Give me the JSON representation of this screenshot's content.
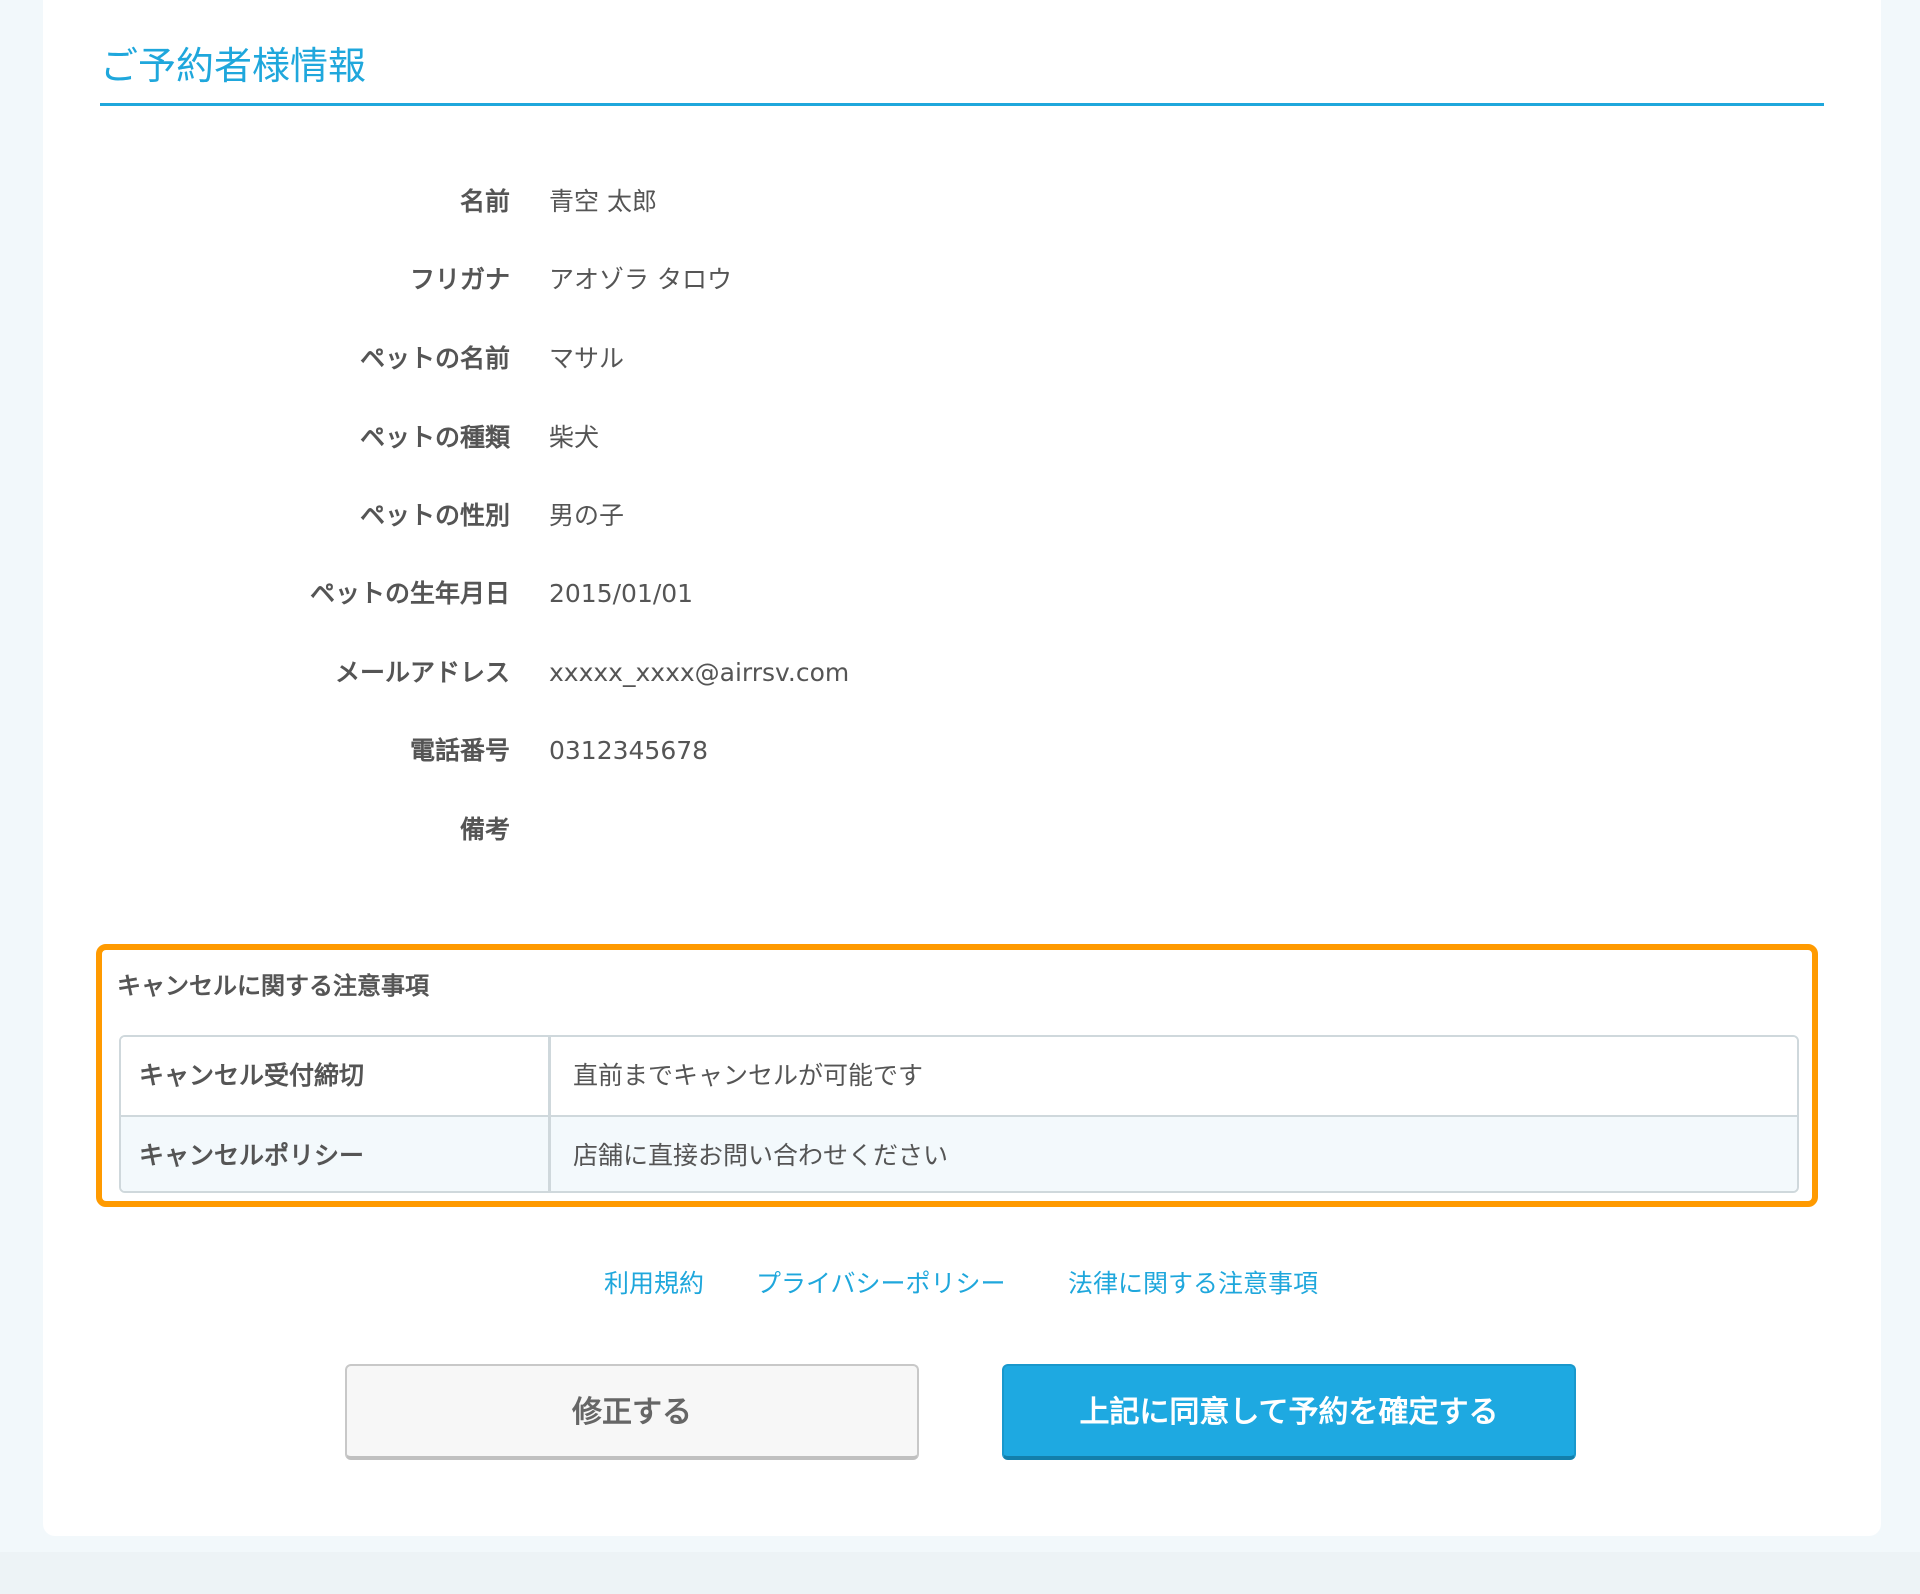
{
  "section": {
    "title": "ご予約者様情報"
  },
  "info": [
    {
      "label": "名前",
      "value": "青空 太郎"
    },
    {
      "label": "フリガナ",
      "value": "アオゾラ タロウ"
    },
    {
      "label": "ペットの名前",
      "value": "マサル"
    },
    {
      "label": "ペットの種類",
      "value": "柴犬"
    },
    {
      "label": "ペットの性別",
      "value": "男の子"
    },
    {
      "label": "ペットの生年月日",
      "value": "2015/01/01"
    },
    {
      "label": "メールアドレス",
      "value": "xxxxx_xxxx@airrsv.com"
    },
    {
      "label": "電話番号",
      "value": "0312345678"
    },
    {
      "label": "備考",
      "value": ""
    }
  ],
  "cancel": {
    "title": "キャンセルに関する注意事項",
    "rows": [
      {
        "key": "キャンセル受付締切",
        "value": "直前までキャンセルが可能です"
      },
      {
        "key": "キャンセルポリシー",
        "value": "店舗に直接お問い合わせください"
      }
    ]
  },
  "links": {
    "terms": "利用規約",
    "privacy": "プライバシーポリシー",
    "legal": "法律に関する注意事項"
  },
  "buttons": {
    "edit": "修正する",
    "confirm": "上記に同意して予約を確定する"
  },
  "colors": {
    "accent": "#1fa7dc",
    "highlight_border": "#ff9a00",
    "primary_button": "#1ea9e1",
    "page_background": "#f2f8fb"
  }
}
